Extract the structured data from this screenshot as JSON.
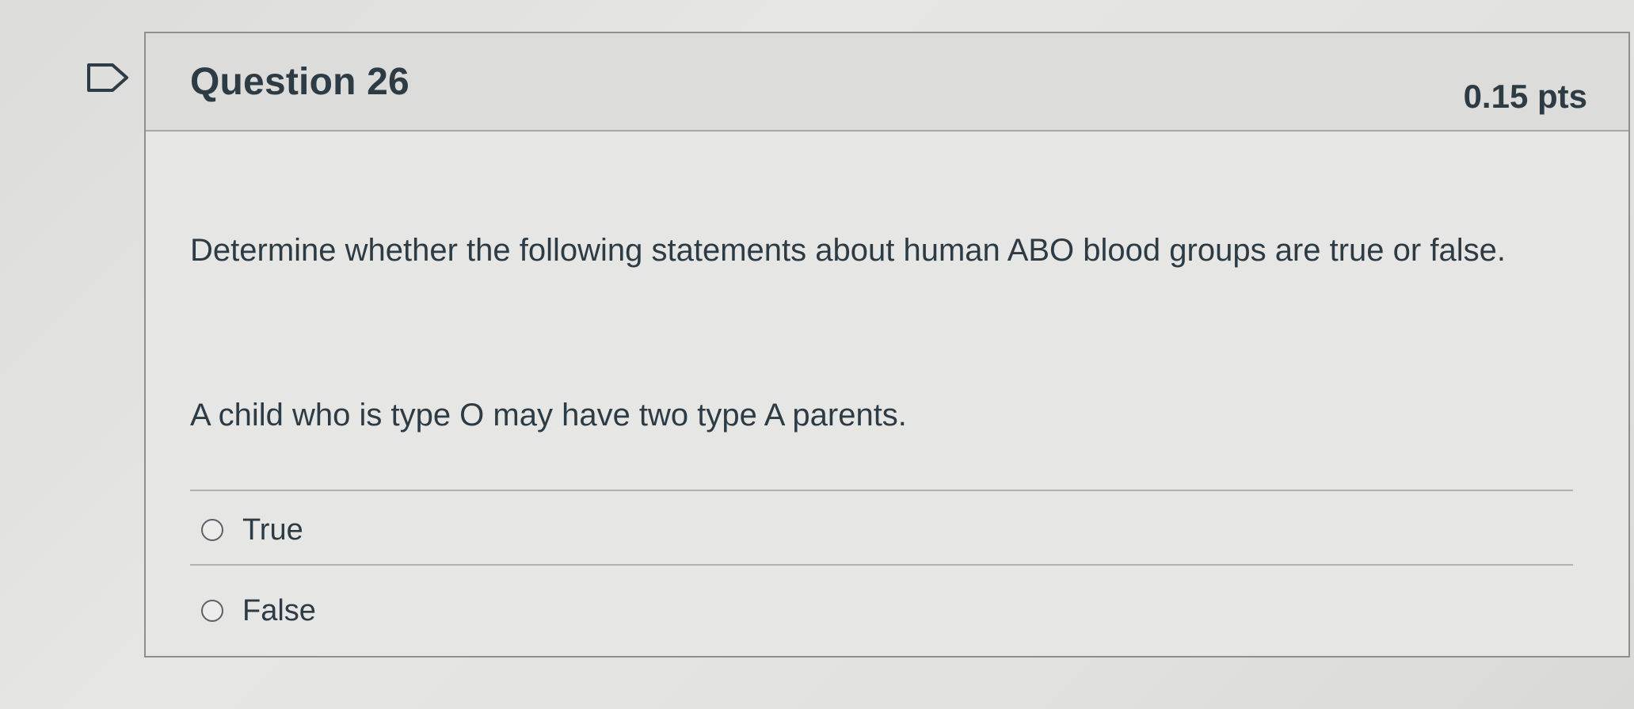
{
  "question": {
    "title": "Question 26",
    "points": "0.15 pts",
    "prompt": "Determine whether the following statements about human ABO blood groups are true or false.",
    "statement": "A child who is type O may have two type A parents.",
    "answers": [
      {
        "label": "True",
        "selected": false
      },
      {
        "label": "False",
        "selected": false
      }
    ]
  },
  "icons": {
    "flag": "flag-question-icon"
  },
  "colors": {
    "text": "#2d3b45",
    "header_background": "#dcdcda",
    "card_background": "#e6e6e4",
    "border": "#8d8f90"
  }
}
